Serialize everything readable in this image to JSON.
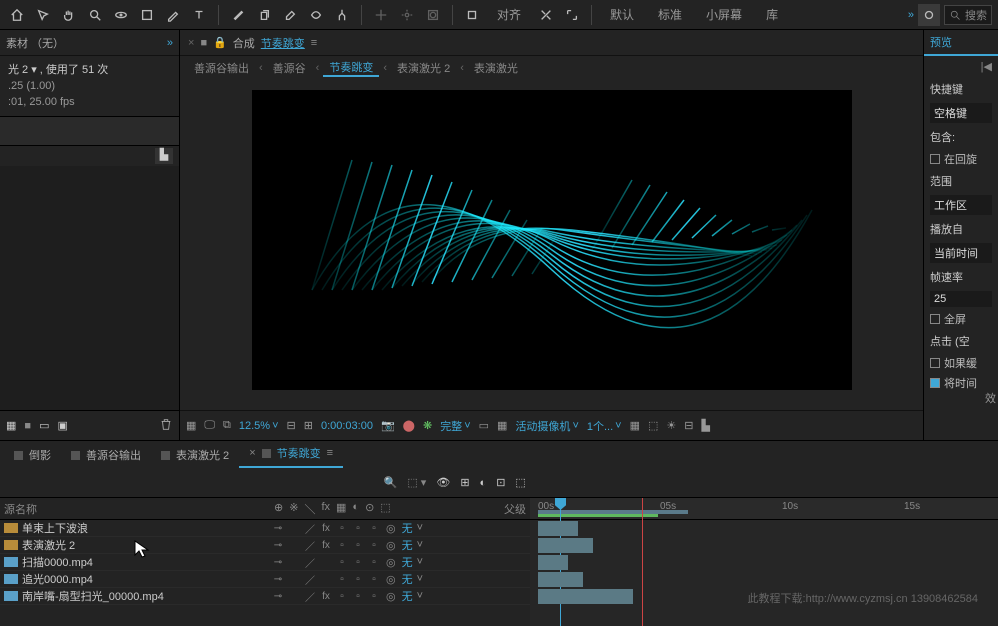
{
  "topbar": {
    "ws_align": "对齐",
    "ws_default": "默认",
    "ws_standard": "标准",
    "ws_small": "小屏幕",
    "ws_lib": "库",
    "more": "»",
    "search_ph": "搜索"
  },
  "project": {
    "panel_title": "素材 （无）",
    "item_line1": "光 2 ▾ , 使用了 51 次",
    "item_line2": ".25 (1.00)",
    "item_line3": ":01, 25.00 fps"
  },
  "comp": {
    "label": "合成",
    "name": "节奏跳变",
    "crumbs": [
      "善源谷输出",
      "善源谷",
      "节奏跳变",
      "表演激光 2",
      "表演激光"
    ],
    "active_crumb": 2
  },
  "viewer_foot": {
    "zoom": "12.5%",
    "time": "0:00:03:00",
    "res": "完整",
    "camera": "活动摄像机",
    "views": "1个..."
  },
  "preview": {
    "title": "预览",
    "shortcut_lbl": "快捷键",
    "shortcut_val": "空格键",
    "include_lbl": "包含:",
    "chk_cache": "在回旋",
    "range_lbl": "范围",
    "range_val": "工作区",
    "playfrom_lbl": "播放自",
    "playfrom_val": "当前时间",
    "fps_lbl": "帧速率",
    "fps_val": "25",
    "chk_full": "全屏",
    "click_lbl": "点击 (空",
    "chk_ifslow": "如果缓",
    "chk_time": "将时间",
    "fx": "效"
  },
  "timeline": {
    "tabs": [
      "倒影",
      "善源谷输出",
      "表演激光 2",
      "节奏跳变"
    ],
    "active_tab": 3,
    "col_source": "源名称",
    "col_parent": "父级",
    "none": "无",
    "ticks": [
      "00s",
      "05s",
      "10s",
      "15s"
    ],
    "layers": [
      {
        "color": "#b88c3a",
        "name": "单束上下波浪",
        "fx": true
      },
      {
        "color": "#b88c3a",
        "name": "表演激光 2",
        "fx": true
      },
      {
        "color": "#5aa0c8",
        "name": "扫描0000.mp4",
        "fx": false
      },
      {
        "color": "#5aa0c8",
        "name": "追光0000.mp4",
        "fx": false
      },
      {
        "color": "#5aa0c8",
        "name": "南岸嘴-扇型扫光_00000.mp4",
        "fx": true
      }
    ]
  },
  "watermark": "此教程下载:http://www.cyzmsj.cn 13908462584"
}
